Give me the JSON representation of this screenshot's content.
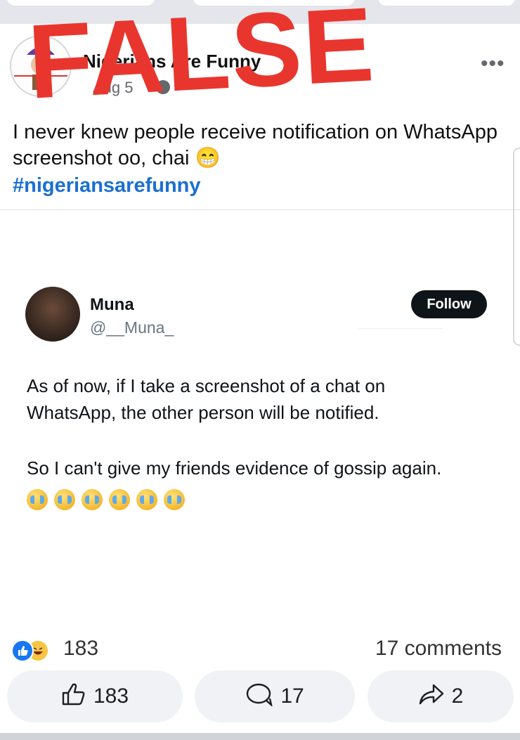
{
  "overlay": {
    "stamp_text": "FALSE",
    "color": "#e8362e"
  },
  "post": {
    "page_name": "Nigerians Are Funny",
    "date": "Aug 5",
    "caption": "I never knew people receive notification on WhatsApp screenshot oo, chai 😁",
    "hashtag": "#nigeriansarefunny"
  },
  "tweet": {
    "name": "Muna",
    "handle": "@__Muna_",
    "follow_label": "Follow",
    "line1": "As of now, if I take a screenshot of a chat on",
    "line2": "WhatsApp, the other person will be notified.",
    "line3": "So I can't give my friends evidence of gossip again."
  },
  "stats": {
    "reactions_count": "183",
    "comments_label": "17 comments"
  },
  "actions": {
    "like_count": "183",
    "comment_count": "17",
    "share_count": "2"
  },
  "icons": {
    "more": "more-options-icon",
    "globe": "globe-icon",
    "like": "thumbs-up-icon",
    "comment": "comment-icon",
    "share": "share-icon",
    "reaction_like": "like-reaction-icon",
    "reaction_haha": "haha-reaction-icon",
    "cry": "loudly-crying-face-icon"
  },
  "colors": {
    "hashtag": "#1b6fd1",
    "follow_bg": "#0f1419",
    "button_bg": "#f0f2f5",
    "accent": "#1877f2"
  }
}
